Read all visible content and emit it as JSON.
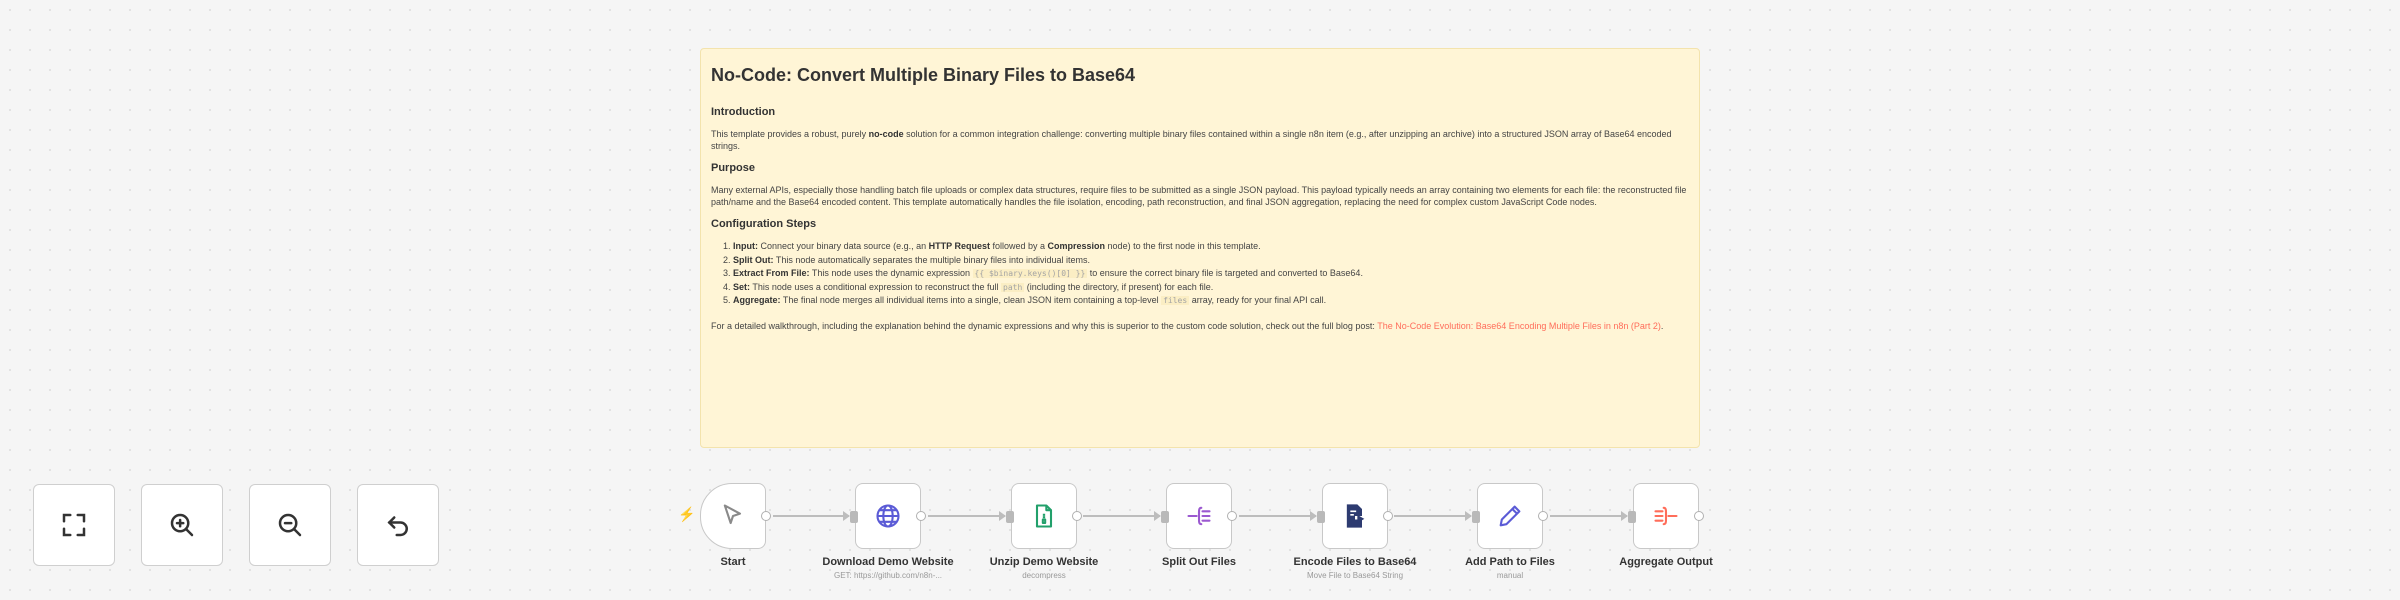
{
  "sticky": {
    "title": "No-Code: Convert Multiple Binary Files to Base64",
    "intro_heading": "Introduction",
    "intro_text_1": "This template provides a robust, purely ",
    "intro_bold": "no-code",
    "intro_text_2": " solution for a common integration challenge: converting multiple binary files contained within a single n8n item (e.g., after unzipping an archive) into a structured JSON array of Base64 encoded strings.",
    "purpose_heading": "Purpose",
    "purpose_text": "Many external APIs, especially those handling batch file uploads or complex data structures, require files to be submitted as a single JSON payload. This payload typically needs an array containing two elements for each file: the reconstructed file path/name and the Base64 encoded content. This template automatically handles the file isolation, encoding, path reconstruction, and final JSON aggregation, replacing the need for complex custom JavaScript Code nodes.",
    "config_heading": "Configuration Steps",
    "steps": [
      {
        "num": "1.",
        "bold": "Input:",
        "text": " Connect your binary data source (e.g., an ",
        "b2": "HTTP Request",
        "t2": " followed by a ",
        "b3": "Compression",
        "t3": " node) to the first node in this template."
      },
      {
        "num": "2.",
        "bold": "Split Out:",
        "text": " This node automatically separates the multiple binary files into individual items."
      },
      {
        "num": "3.",
        "bold": "Extract From File:",
        "text": " This node uses the dynamic expression ",
        "code": "{{ $binary.keys()[0] }}",
        "t2": " to ensure the correct binary file is targeted and converted to Base64."
      },
      {
        "num": "4.",
        "bold": "Set:",
        "text": " This node uses a conditional expression to reconstruct the full ",
        "code": "path",
        "t2": " (including the directory, if present) for each file."
      },
      {
        "num": "5.",
        "bold": "Aggregate:",
        "text": " The final node merges all individual items into a single, clean JSON item containing a top-level ",
        "code": "files",
        "t2": " array, ready for your final API call."
      }
    ],
    "footer_text": "For a detailed walkthrough, including the explanation behind the dynamic expressions and why this is superior to the custom code solution, check out the full blog post: ",
    "footer_link": "The No-Code Evolution: Base64 Encoding Multiple Files in n8n (Part 2)",
    "footer_end": "."
  },
  "controls": [
    {
      "name": "fit-view-button",
      "icon": "fit-view-icon"
    },
    {
      "name": "zoom-in-button",
      "icon": "zoom-in-icon"
    },
    {
      "name": "zoom-out-button",
      "icon": "zoom-out-icon"
    },
    {
      "name": "reset-zoom-button",
      "icon": "undo-icon"
    }
  ],
  "nodes": [
    {
      "label": "Start",
      "sub": "",
      "icon": "cursor-icon",
      "color": "#8a8a8a"
    },
    {
      "label": "Download Demo Website",
      "sub": "GET: https://github.com/n8n-...",
      "icon": "globe-icon",
      "color": "#5b5bd6"
    },
    {
      "label": "Unzip Demo Website",
      "sub": "decompress",
      "icon": "file-archive-icon",
      "color": "#22a06b"
    },
    {
      "label": "Split Out Files",
      "sub": "",
      "icon": "split-icon",
      "color": "#9b59d0"
    },
    {
      "label": "Encode Files to Base64",
      "sub": "Move File to Base64 String",
      "icon": "file-export-icon",
      "color": "#2d3b70"
    },
    {
      "label": "Add Path to Files",
      "sub": "manual",
      "icon": "pen-icon",
      "color": "#5b5bd6"
    },
    {
      "label": "Aggregate Output",
      "sub": "",
      "icon": "aggregate-icon",
      "color": "#ff6d5a"
    }
  ]
}
